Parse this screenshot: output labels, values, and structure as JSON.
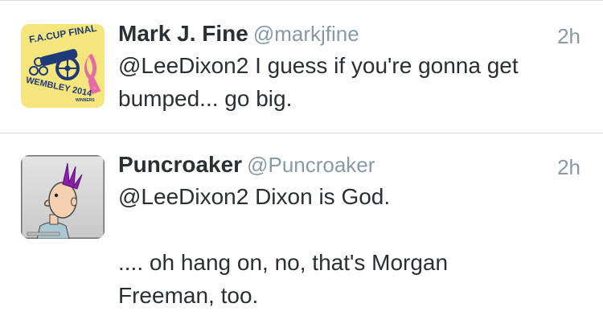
{
  "tweets": [
    {
      "avatar": "fa-cup-final-wembley-badge",
      "avatar_text": {
        "top": "F.A.CUP FINAL",
        "bottom": "WEMBLEY 2014",
        "small": "WINNERS"
      },
      "display_name": "Mark J. Fine",
      "handle": "@markjfine",
      "time": "2h",
      "text": "@LeeDixon2 I guess if you're gonna get\nbumped... go big."
    },
    {
      "avatar": "punk-cartoon-character",
      "display_name": "Puncroaker",
      "handle": "@Puncroaker",
      "time": "2h",
      "text": "@LeeDixon2 Dixon is God.\n\n.... oh hang on, no, that's Morgan\nFreeman, too."
    }
  ],
  "colors": {
    "name": "#292f33",
    "meta": "#8899a6",
    "divider": "#d9dde0",
    "avatar1_bg": "#f3e26b"
  }
}
